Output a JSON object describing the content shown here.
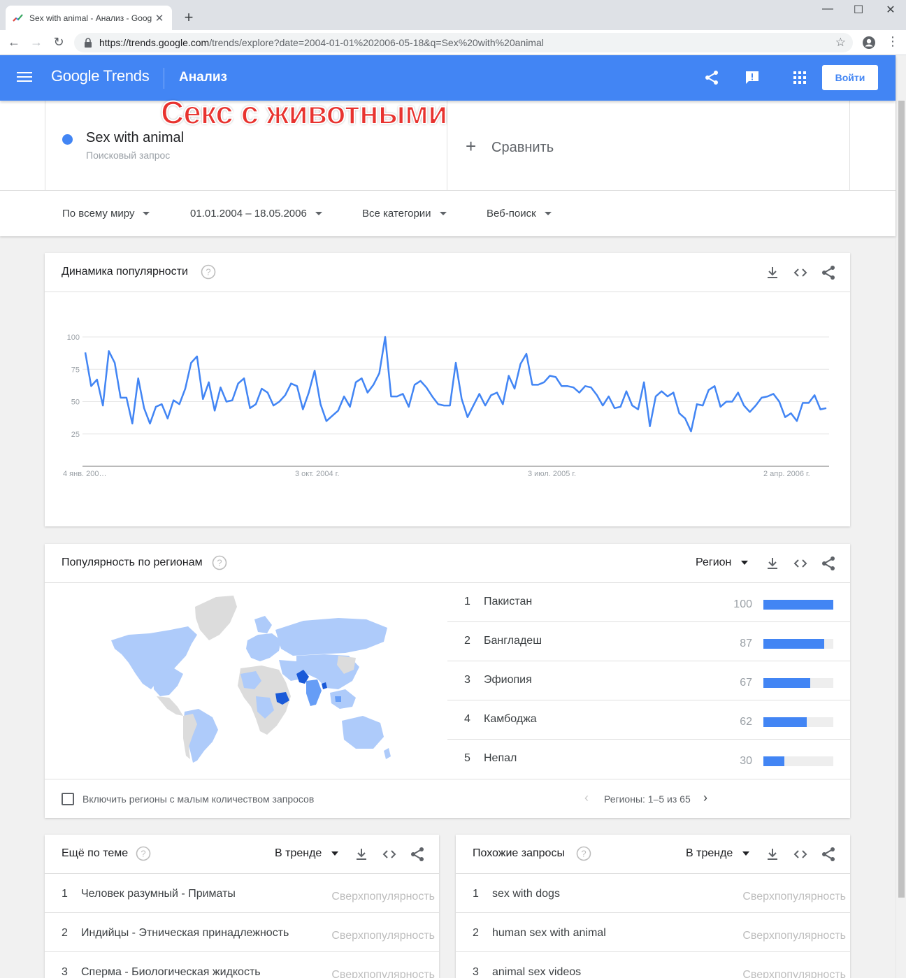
{
  "browser": {
    "tab_title": "Sex with animal - Анализ - Goog",
    "url_host": "https://trends.google.com",
    "url_path": "/trends/explore?date=2004-01-01%202006-05-18&q=Sex%20with%20animal"
  },
  "header": {
    "logo": "Google Trends",
    "section": "Анализ",
    "signin_label": "Войти"
  },
  "overlay_title": "Секс с животными",
  "search": {
    "term": "Sex with animal",
    "term_type": "Поисковый запрос",
    "compare_label": "Сравнить"
  },
  "filters": {
    "region": "По всему миру",
    "dates": "01.01.2004 – 18.05.2006",
    "category": "Все категории",
    "search_type": "Веб-поиск"
  },
  "interest_card": {
    "title": "Динамика популярности"
  },
  "chart_data": {
    "type": "line",
    "y_ticks": [
      "100",
      "75",
      "50",
      "25"
    ],
    "x_ticks": [
      "4 янв. 200…",
      "3 окт. 2004 г.",
      "3 июл. 2005 г.",
      "2 апр. 2006 г."
    ],
    "ylim": [
      0,
      100
    ],
    "grid": true,
    "series": [
      {
        "color": "#4285f4",
        "values": [
          88,
          62,
          67,
          47,
          89,
          80,
          53,
          53,
          33,
          68,
          45,
          33,
          46,
          48,
          37,
          51,
          48,
          60,
          80,
          85,
          52,
          65,
          43,
          61,
          50,
          51,
          64,
          68,
          45,
          48,
          60,
          57,
          47,
          50,
          55,
          64,
          62,
          44,
          57,
          74,
          48,
          35,
          39,
          43,
          54,
          46,
          65,
          68,
          57,
          63,
          72,
          100,
          54,
          54,
          56,
          46,
          63,
          66,
          61,
          54,
          48,
          47,
          47,
          80,
          52,
          38,
          47,
          56,
          47,
          55,
          57,
          48,
          70,
          60,
          79,
          87,
          63,
          63,
          65,
          70,
          69,
          62,
          62,
          61,
          57,
          62,
          61,
          55,
          47,
          54,
          45,
          46,
          58,
          47,
          44,
          65,
          31,
          54,
          58,
          54,
          57,
          41,
          37,
          27,
          48,
          47,
          59,
          62,
          46,
          50,
          50,
          57,
          47,
          42,
          47,
          53,
          54,
          56,
          50,
          38,
          41,
          35,
          49,
          49,
          55,
          44,
          45
        ]
      }
    ]
  },
  "region_card": {
    "title": "Популярность по регионам",
    "dropdown": "Регион",
    "rows": [
      {
        "rank": "1",
        "name": "Пакистан",
        "value": "100",
        "fraction": 1.0
      },
      {
        "rank": "2",
        "name": "Бангладеш",
        "value": "87",
        "fraction": 0.87
      },
      {
        "rank": "3",
        "name": "Эфиопия",
        "value": "67",
        "fraction": 0.67
      },
      {
        "rank": "4",
        "name": "Камбоджа",
        "value": "62",
        "fraction": 0.62
      },
      {
        "rank": "5",
        "name": "Непал",
        "value": "30",
        "fraction": 0.3
      }
    ],
    "include_low_volume": "Включить регионы с малым количеством запросов",
    "pager": "Регионы: 1–5 из 65"
  },
  "topics_card": {
    "title": "Ещё по теме",
    "dropdown": "В тренде",
    "rows": [
      {
        "rank": "1",
        "name": "Человек разумный - Приматы",
        "value": "Сверхпопулярность"
      },
      {
        "rank": "2",
        "name": "Индийцы - Этническая принадлежность",
        "value": "Сверхпопулярность"
      },
      {
        "rank": "3",
        "name": "Сперма - Биологическая жидкость",
        "value": "Сверхпопулярность"
      }
    ]
  },
  "queries_card": {
    "title": "Похожие запросы",
    "dropdown": "В тренде",
    "rows": [
      {
        "rank": "1",
        "name": "sex with dogs",
        "value": "Сверхпопулярность"
      },
      {
        "rank": "2",
        "name": "human sex with animal",
        "value": "Сверхпопулярность"
      },
      {
        "rank": "3",
        "name": "animal sex videos",
        "value": "Сверхпопулярность"
      }
    ]
  },
  "colors": {
    "brand": "#4285f4",
    "map_low": "#aecbfa",
    "map_mid": "#669df6",
    "map_high": "#1a5ad8",
    "map_none": "#dcdcdc"
  }
}
